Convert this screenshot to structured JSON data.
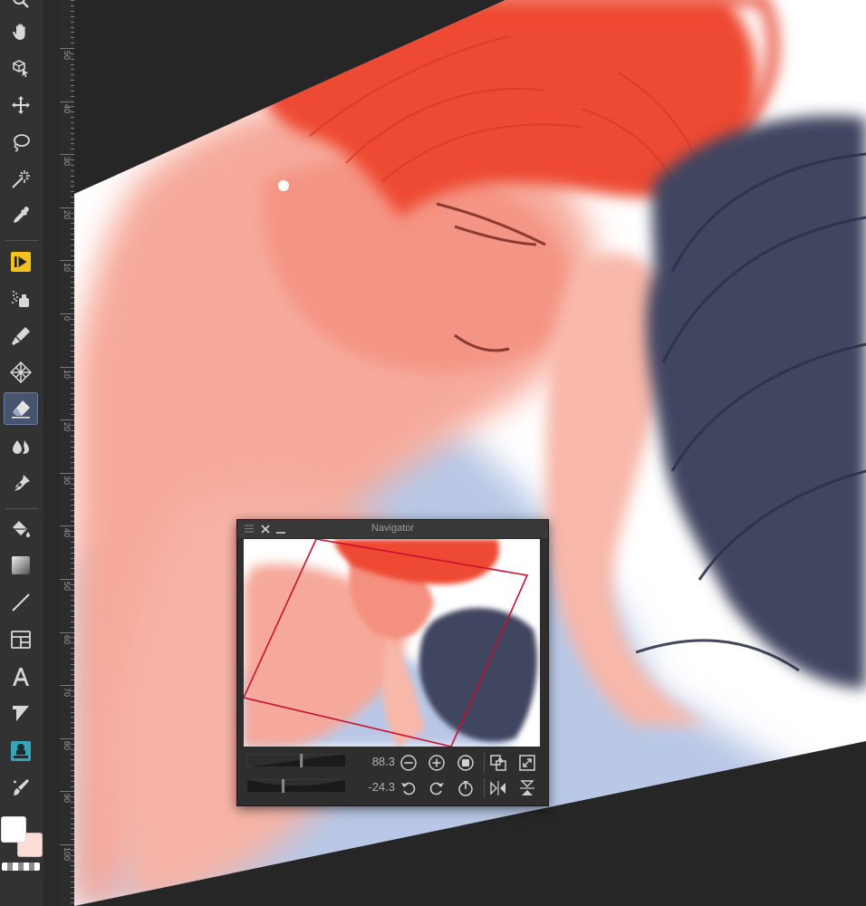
{
  "toolbar": {
    "tools": [
      {
        "name": "zoom-tool",
        "icon": "magnifier-icon"
      },
      {
        "name": "hand-tool",
        "icon": "hand-icon"
      },
      {
        "name": "object-tool",
        "icon": "object-cursor-icon"
      },
      {
        "name": "move-tool",
        "icon": "move-arrows-icon"
      },
      {
        "name": "lasso-tool",
        "icon": "lasso-icon"
      },
      {
        "name": "auto-select-tool",
        "icon": "magic-wand-icon"
      },
      {
        "name": "eyedropper-tool",
        "icon": "eyedropper-icon"
      },
      {
        "name": "timelapse-tool",
        "icon": "play-frame-icon"
      },
      {
        "name": "airbrush-tool",
        "icon": "airbrush-icon"
      },
      {
        "name": "pen-tool",
        "icon": "pen-icon"
      },
      {
        "name": "decoration-tool",
        "icon": "pattern-icon"
      },
      {
        "name": "eraser-tool",
        "icon": "eraser-icon",
        "active": true
      },
      {
        "name": "blend-tool",
        "icon": "droplets-icon"
      },
      {
        "name": "brush-tool",
        "icon": "brush-nib-icon"
      },
      {
        "name": "fill-tool",
        "icon": "paint-bucket-icon"
      },
      {
        "name": "gradient-tool",
        "icon": "gradient-icon"
      },
      {
        "name": "figure-tool",
        "icon": "line-icon"
      },
      {
        "name": "frame-tool",
        "icon": "frame-border-icon"
      },
      {
        "name": "text-tool",
        "icon": "text-icon"
      },
      {
        "name": "balloon-tool",
        "icon": "balloon-icon"
      },
      {
        "name": "correct-line-tool",
        "icon": "stamp-icon"
      },
      {
        "name": "scissor-tool",
        "icon": "magic-brush-icon"
      }
    ],
    "main_color": "#ffffff",
    "sub_color": "#fcded6"
  },
  "ruler": {
    "labels": [
      "50",
      "40",
      "30",
      "20",
      "10",
      "0",
      "10",
      "20",
      "30",
      "40",
      "50",
      "60",
      "70",
      "80",
      "90",
      "100"
    ]
  },
  "navigator": {
    "title": "Navigator",
    "zoom_value": "88.3",
    "rotation_value": "-24.3",
    "zoom": 88.3,
    "rotation": -24.3
  },
  "colors": {
    "accent_red": "#c8102e",
    "hair_red": "#ee4a32",
    "skin": "#f6a99a",
    "hair_dark": "#3f4460",
    "shirt_blue": "#b9c8e6"
  }
}
